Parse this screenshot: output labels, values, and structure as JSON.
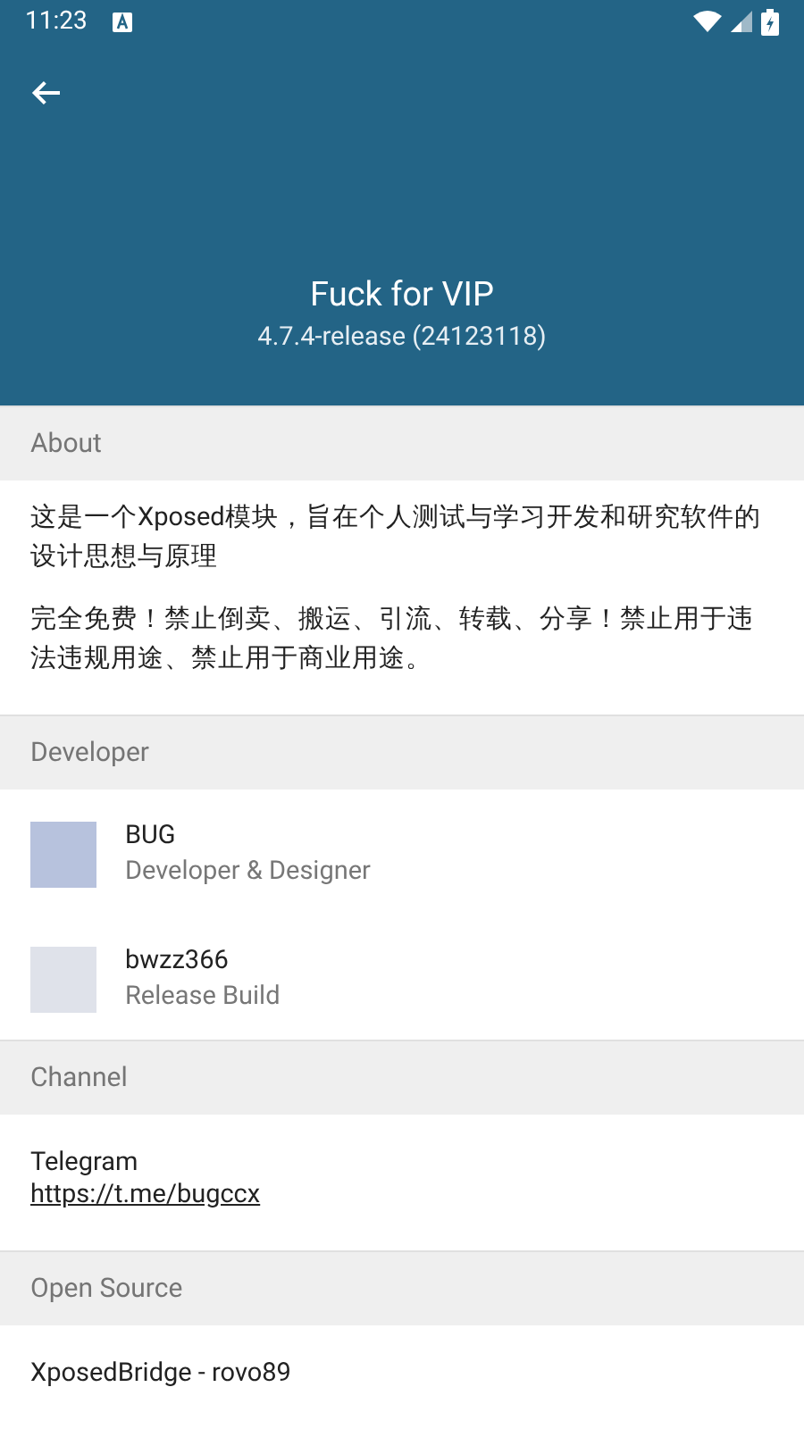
{
  "status_bar": {
    "time": "11:23"
  },
  "app": {
    "name": "Fuck for VIP",
    "version": "4.7.4-release (24123118)"
  },
  "sections": [
    {
      "kind": "text",
      "title": "About",
      "paragraphs": [
        "这是一个Xposed模块，旨在个人测试与学习开发和研究软件的设计思想与原理",
        "完全免费！禁止倒卖、搬运、引流、转载、分享！禁止用于违法违规用途、禁止用于商业用途。"
      ]
    },
    {
      "kind": "people",
      "title": "Developer",
      "people": [
        {
          "name": "BUG",
          "role": "Developer & Designer"
        },
        {
          "name": "bwzz366",
          "role": "Release Build"
        }
      ]
    },
    {
      "kind": "links",
      "title": "Channel",
      "links": [
        {
          "name": "Telegram",
          "url": "https://t.me/bugccx"
        }
      ]
    },
    {
      "kind": "links",
      "title": "Open Source",
      "links": [
        {
          "name": "XposedBridge - rovo89"
        }
      ]
    }
  ]
}
